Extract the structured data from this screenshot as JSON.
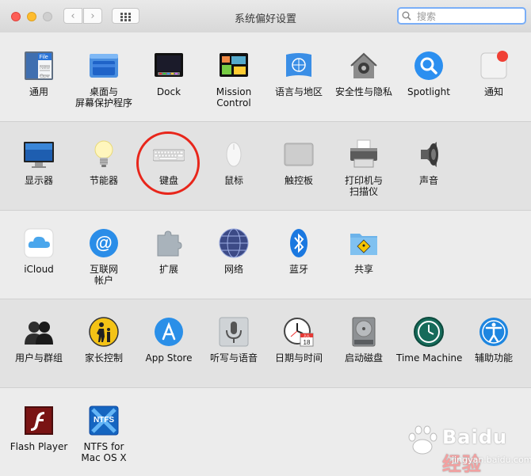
{
  "window": {
    "title": "系统偏好设置"
  },
  "search": {
    "placeholder": "搜索"
  },
  "rows": [
    {
      "items": [
        {
          "id": "general",
          "label": "通用"
        },
        {
          "id": "desktop",
          "label": "桌面与\n屏幕保护程序"
        },
        {
          "id": "dock",
          "label": "Dock"
        },
        {
          "id": "mission",
          "label": "Mission\nControl"
        },
        {
          "id": "language",
          "label": "语言与地区"
        },
        {
          "id": "security",
          "label": "安全性与隐私"
        },
        {
          "id": "spotlight",
          "label": "Spotlight"
        },
        {
          "id": "notify",
          "label": "通知"
        }
      ]
    },
    {
      "items": [
        {
          "id": "display",
          "label": "显示器"
        },
        {
          "id": "energy",
          "label": "节能器"
        },
        {
          "id": "keyboard",
          "label": "键盘"
        },
        {
          "id": "mouse",
          "label": "鼠标"
        },
        {
          "id": "trackpad",
          "label": "触控板"
        },
        {
          "id": "printer",
          "label": "打印机与\n扫描仪"
        },
        {
          "id": "sound",
          "label": "声音"
        }
      ]
    },
    {
      "items": [
        {
          "id": "icloud",
          "label": "iCloud"
        },
        {
          "id": "internet",
          "label": "互联网\n帐户"
        },
        {
          "id": "extensions",
          "label": "扩展"
        },
        {
          "id": "network",
          "label": "网络"
        },
        {
          "id": "bluetooth",
          "label": "蓝牙"
        },
        {
          "id": "sharing",
          "label": "共享"
        }
      ]
    },
    {
      "items": [
        {
          "id": "users",
          "label": "用户与群组"
        },
        {
          "id": "parental",
          "label": "家长控制"
        },
        {
          "id": "appstore",
          "label": "App Store"
        },
        {
          "id": "dictation",
          "label": "听写与语音"
        },
        {
          "id": "datetime",
          "label": "日期与时间"
        },
        {
          "id": "startup",
          "label": "启动磁盘"
        },
        {
          "id": "timemachine",
          "label": "Time Machine"
        },
        {
          "id": "accessibility",
          "label": "辅助功能"
        }
      ]
    },
    {
      "items": [
        {
          "id": "flash",
          "label": "Flash Player"
        },
        {
          "id": "ntfs",
          "label": "NTFS for\nMac OS X"
        }
      ]
    }
  ],
  "icon_text": {
    "general_file": "File",
    "general_new": "New",
    "general_ope": "Ope",
    "calendar_month": "JUL",
    "calendar_day": "18",
    "ntfs": "NTFS"
  },
  "watermark": {
    "brand_a": "Bai",
    "brand_b": "du",
    "brand_c": "经验",
    "url": "jingyan.baidu.com"
  }
}
